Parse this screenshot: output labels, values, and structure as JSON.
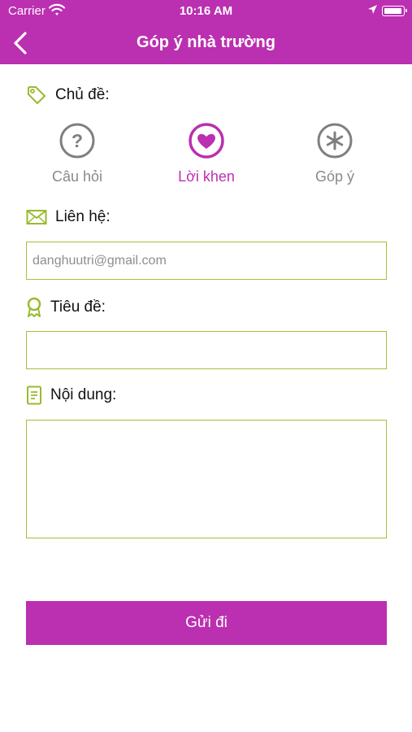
{
  "status_bar": {
    "carrier": "Carrier",
    "time": "10:16 AM"
  },
  "header": {
    "title": "Góp ý nhà trường",
    "back_icon": "chevron-left-icon"
  },
  "topic": {
    "label": "Chủ đề:",
    "icon": "tag-icon",
    "selected": "Lời khen",
    "options": [
      {
        "label": "Câu hỏi",
        "icon": "question-circle-icon"
      },
      {
        "label": "Lời khen",
        "icon": "heart-circle-icon"
      },
      {
        "label": "Góp ý",
        "icon": "asterisk-circle-icon"
      }
    ]
  },
  "contact": {
    "label": "Liên hệ:",
    "icon": "envelope-icon",
    "placeholder": "danghuutri@gmail.com",
    "value": ""
  },
  "subject": {
    "label": "Tiêu đề:",
    "icon": "ribbon-icon",
    "value": ""
  },
  "content": {
    "label": "Nội dung:",
    "icon": "document-icon",
    "value": ""
  },
  "submit": {
    "label": "Gửi đi"
  },
  "colors": {
    "accent": "#bb2fb1",
    "border": "#a6c13a",
    "icon_green": "#9aba2e",
    "inactive": "#8a8a8a"
  }
}
